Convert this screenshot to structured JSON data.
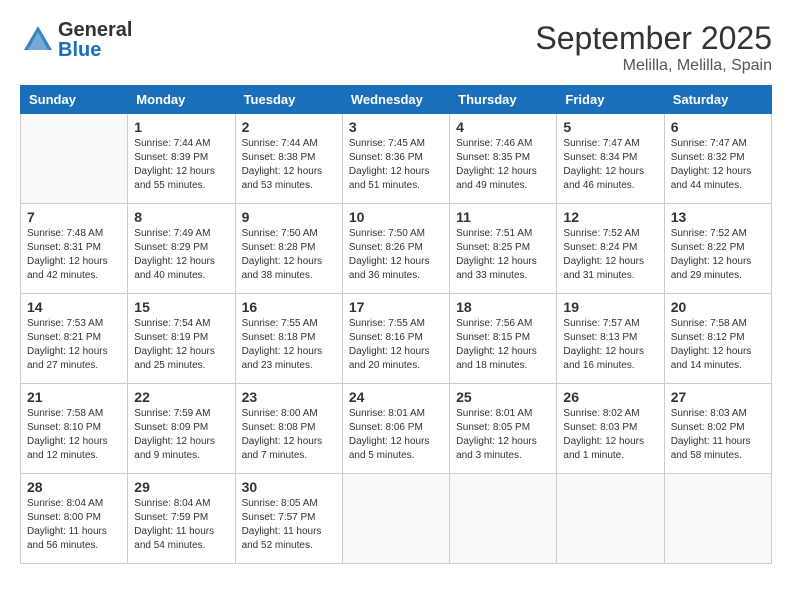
{
  "header": {
    "logo_general": "General",
    "logo_blue": "Blue",
    "month": "September 2025",
    "location": "Melilla, Melilla, Spain"
  },
  "weekdays": [
    "Sunday",
    "Monday",
    "Tuesday",
    "Wednesday",
    "Thursday",
    "Friday",
    "Saturday"
  ],
  "weeks": [
    [
      {
        "day": "",
        "info": ""
      },
      {
        "day": "1",
        "info": "Sunrise: 7:44 AM\nSunset: 8:39 PM\nDaylight: 12 hours\nand 55 minutes."
      },
      {
        "day": "2",
        "info": "Sunrise: 7:44 AM\nSunset: 8:38 PM\nDaylight: 12 hours\nand 53 minutes."
      },
      {
        "day": "3",
        "info": "Sunrise: 7:45 AM\nSunset: 8:36 PM\nDaylight: 12 hours\nand 51 minutes."
      },
      {
        "day": "4",
        "info": "Sunrise: 7:46 AM\nSunset: 8:35 PM\nDaylight: 12 hours\nand 49 minutes."
      },
      {
        "day": "5",
        "info": "Sunrise: 7:47 AM\nSunset: 8:34 PM\nDaylight: 12 hours\nand 46 minutes."
      },
      {
        "day": "6",
        "info": "Sunrise: 7:47 AM\nSunset: 8:32 PM\nDaylight: 12 hours\nand 44 minutes."
      }
    ],
    [
      {
        "day": "7",
        "info": "Sunrise: 7:48 AM\nSunset: 8:31 PM\nDaylight: 12 hours\nand 42 minutes."
      },
      {
        "day": "8",
        "info": "Sunrise: 7:49 AM\nSunset: 8:29 PM\nDaylight: 12 hours\nand 40 minutes."
      },
      {
        "day": "9",
        "info": "Sunrise: 7:50 AM\nSunset: 8:28 PM\nDaylight: 12 hours\nand 38 minutes."
      },
      {
        "day": "10",
        "info": "Sunrise: 7:50 AM\nSunset: 8:26 PM\nDaylight: 12 hours\nand 36 minutes."
      },
      {
        "day": "11",
        "info": "Sunrise: 7:51 AM\nSunset: 8:25 PM\nDaylight: 12 hours\nand 33 minutes."
      },
      {
        "day": "12",
        "info": "Sunrise: 7:52 AM\nSunset: 8:24 PM\nDaylight: 12 hours\nand 31 minutes."
      },
      {
        "day": "13",
        "info": "Sunrise: 7:52 AM\nSunset: 8:22 PM\nDaylight: 12 hours\nand 29 minutes."
      }
    ],
    [
      {
        "day": "14",
        "info": "Sunrise: 7:53 AM\nSunset: 8:21 PM\nDaylight: 12 hours\nand 27 minutes."
      },
      {
        "day": "15",
        "info": "Sunrise: 7:54 AM\nSunset: 8:19 PM\nDaylight: 12 hours\nand 25 minutes."
      },
      {
        "day": "16",
        "info": "Sunrise: 7:55 AM\nSunset: 8:18 PM\nDaylight: 12 hours\nand 23 minutes."
      },
      {
        "day": "17",
        "info": "Sunrise: 7:55 AM\nSunset: 8:16 PM\nDaylight: 12 hours\nand 20 minutes."
      },
      {
        "day": "18",
        "info": "Sunrise: 7:56 AM\nSunset: 8:15 PM\nDaylight: 12 hours\nand 18 minutes."
      },
      {
        "day": "19",
        "info": "Sunrise: 7:57 AM\nSunset: 8:13 PM\nDaylight: 12 hours\nand 16 minutes."
      },
      {
        "day": "20",
        "info": "Sunrise: 7:58 AM\nSunset: 8:12 PM\nDaylight: 12 hours\nand 14 minutes."
      }
    ],
    [
      {
        "day": "21",
        "info": "Sunrise: 7:58 AM\nSunset: 8:10 PM\nDaylight: 12 hours\nand 12 minutes."
      },
      {
        "day": "22",
        "info": "Sunrise: 7:59 AM\nSunset: 8:09 PM\nDaylight: 12 hours\nand 9 minutes."
      },
      {
        "day": "23",
        "info": "Sunrise: 8:00 AM\nSunset: 8:08 PM\nDaylight: 12 hours\nand 7 minutes."
      },
      {
        "day": "24",
        "info": "Sunrise: 8:01 AM\nSunset: 8:06 PM\nDaylight: 12 hours\nand 5 minutes."
      },
      {
        "day": "25",
        "info": "Sunrise: 8:01 AM\nSunset: 8:05 PM\nDaylight: 12 hours\nand 3 minutes."
      },
      {
        "day": "26",
        "info": "Sunrise: 8:02 AM\nSunset: 8:03 PM\nDaylight: 12 hours\nand 1 minute."
      },
      {
        "day": "27",
        "info": "Sunrise: 8:03 AM\nSunset: 8:02 PM\nDaylight: 11 hours\nand 58 minutes."
      }
    ],
    [
      {
        "day": "28",
        "info": "Sunrise: 8:04 AM\nSunset: 8:00 PM\nDaylight: 11 hours\nand 56 minutes."
      },
      {
        "day": "29",
        "info": "Sunrise: 8:04 AM\nSunset: 7:59 PM\nDaylight: 11 hours\nand 54 minutes."
      },
      {
        "day": "30",
        "info": "Sunrise: 8:05 AM\nSunset: 7:57 PM\nDaylight: 11 hours\nand 52 minutes."
      },
      {
        "day": "",
        "info": ""
      },
      {
        "day": "",
        "info": ""
      },
      {
        "day": "",
        "info": ""
      },
      {
        "day": "",
        "info": ""
      }
    ]
  ]
}
